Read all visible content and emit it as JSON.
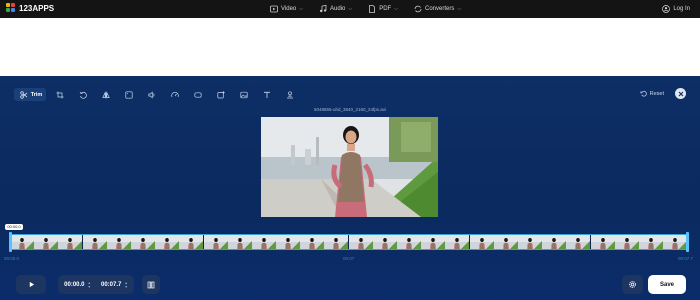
{
  "app": {
    "logo_text": "123APPS"
  },
  "nav": {
    "items": [
      {
        "label": "Video",
        "icon": "video-icon"
      },
      {
        "label": "Audio",
        "icon": "music-note-icon"
      },
      {
        "label": "PDF",
        "icon": "pdf-icon"
      },
      {
        "label": "Converters",
        "icon": "convert-icon"
      }
    ],
    "login_label": "Log In"
  },
  "toolbar": {
    "trim_label": "Trim",
    "tools": [
      "trim-icon",
      "crop-icon",
      "rotate-icon",
      "flip-icon",
      "resize-icon",
      "volume-icon",
      "speed-icon",
      "loop-icon",
      "add-image-icon",
      "image-icon",
      "text-icon",
      "watermark-icon"
    ],
    "reset_label": "Reset"
  },
  "video": {
    "filename": "5048865-uhd_3840_2160_24fps.avi"
  },
  "timeline": {
    "start_marker": "00:00.0",
    "left_time": "00:00.0",
    "mid_time": "00:07",
    "right_time": "00:07.7"
  },
  "controls": {
    "start_time": "00:00.0",
    "end_time": "00:07.7",
    "save_label": "Save"
  },
  "colors": {
    "editor_bg": "#0b2a5e",
    "accent": "#56c3ff",
    "topbar": "#141414"
  }
}
